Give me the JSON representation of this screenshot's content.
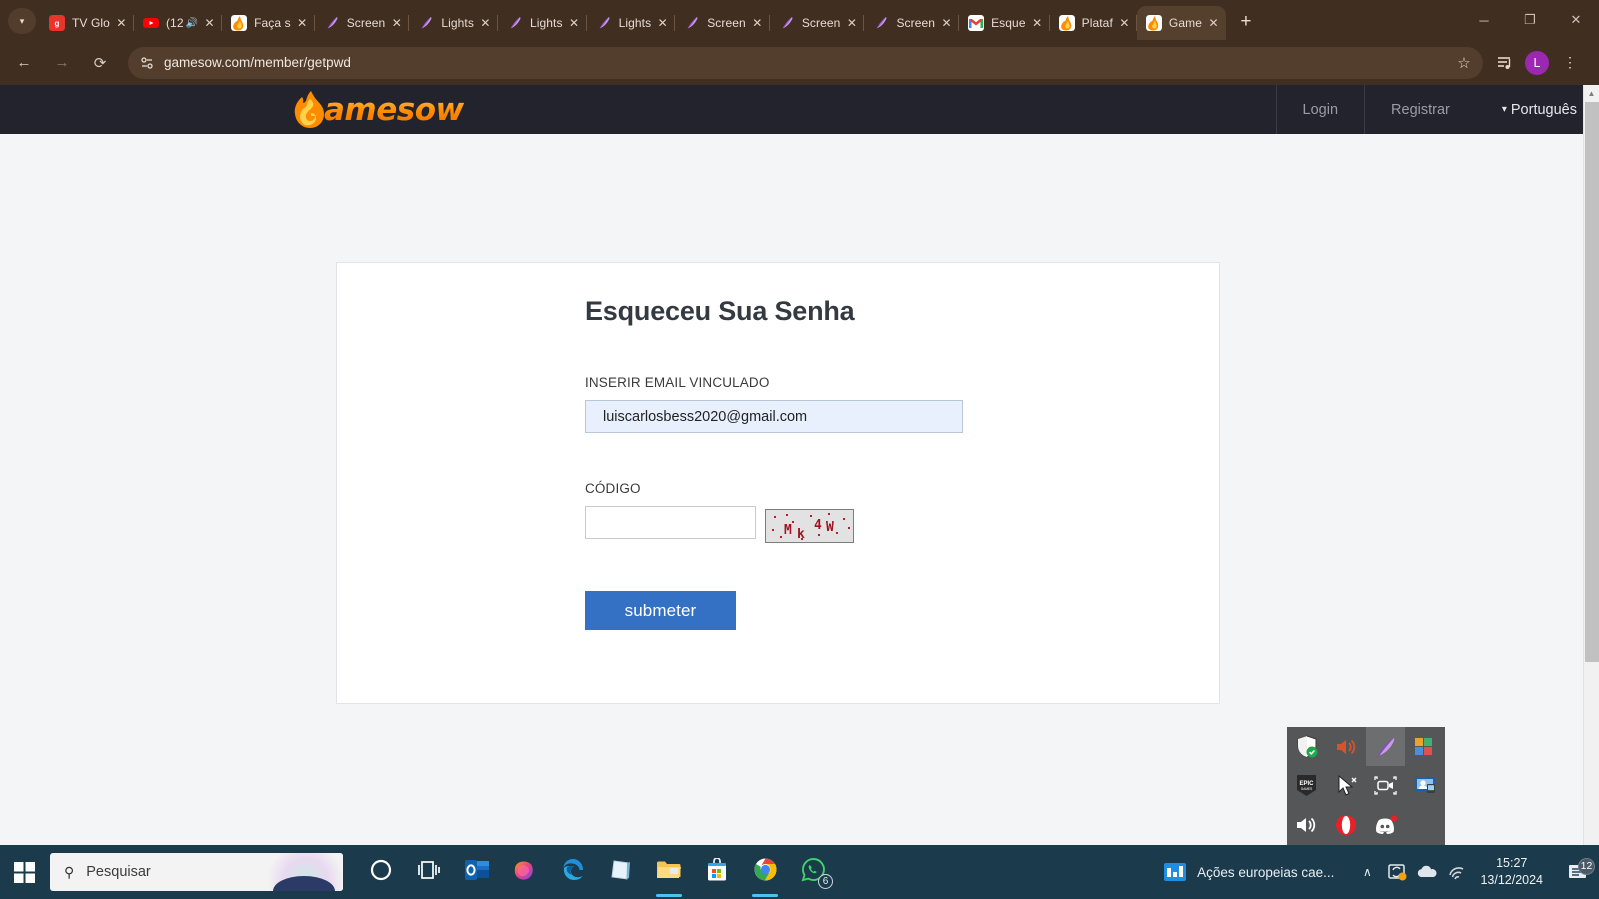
{
  "browser": {
    "tabs": [
      {
        "title": "TV Glo",
        "icon": "globoplay-icon",
        "color": "#e8342a",
        "glyph": "g",
        "audio": false,
        "active": false
      },
      {
        "title": "(12",
        "icon": "youtube-icon",
        "color": "#ff0000",
        "glyph": "▶",
        "audio": true,
        "active": false
      },
      {
        "title": "Faça s",
        "icon": "gamesow-icon",
        "color": "#f5a623",
        "glyph": "G",
        "audio": false,
        "active": false
      },
      {
        "title": "Screen",
        "icon": "lightshot-icon",
        "color": "transparent",
        "glyph": "✒",
        "audio": false,
        "active": false
      },
      {
        "title": "Lights",
        "icon": "lightshot-icon",
        "color": "transparent",
        "glyph": "✒",
        "audio": false,
        "active": false
      },
      {
        "title": "Lights",
        "icon": "lightshot-icon",
        "color": "transparent",
        "glyph": "✒",
        "audio": false,
        "active": false
      },
      {
        "title": "Lights",
        "icon": "lightshot-icon",
        "color": "transparent",
        "glyph": "✒",
        "audio": false,
        "active": false
      },
      {
        "title": "Screen",
        "icon": "lightshot-icon",
        "color": "transparent",
        "glyph": "✒",
        "audio": false,
        "active": false
      },
      {
        "title": "Screen",
        "icon": "lightshot-icon",
        "color": "transparent",
        "glyph": "✒",
        "audio": false,
        "active": false
      },
      {
        "title": "Screen",
        "icon": "lightshot-icon",
        "color": "transparent",
        "glyph": "✒",
        "audio": false,
        "active": false
      },
      {
        "title": "Esque",
        "icon": "gmail-icon",
        "color": "#ffffff",
        "glyph": "M",
        "audio": false,
        "active": false
      },
      {
        "title": "Plataf",
        "icon": "gamesow-icon",
        "color": "#f5a623",
        "glyph": "G",
        "audio": false,
        "active": false
      },
      {
        "title": "Game",
        "icon": "gamesow-icon",
        "color": "#f5a623",
        "glyph": "G",
        "audio": false,
        "active": true
      }
    ],
    "newtab_label": "+",
    "window_controls": {
      "minimize": "─",
      "maximize": "❐",
      "close": "✕"
    },
    "nav": {
      "back": "←",
      "forward": "→",
      "reload": "⟳"
    },
    "url": "gamesow.com/member/getpwd",
    "bookmark_icon": "☆",
    "reading_list_icon": "☰",
    "profile_initial": "L",
    "menu_icon": "⋮"
  },
  "site": {
    "logo_text": "amesow",
    "nav": [
      {
        "label": "Login"
      },
      {
        "label": "Registrar"
      }
    ],
    "language": {
      "caret": "▾",
      "label": "Português"
    }
  },
  "form": {
    "title": "Esqueceu Sua Senha",
    "email_label": "INSERIR EMAIL VINCULADO",
    "email_value": "luiscarlosbess2020@gmail.com",
    "email_placeholder": "",
    "code_label": "CÓDIGO",
    "code_value": "",
    "code_placeholder": "",
    "captcha_text": "Mk4W",
    "captcha_chars": [
      "M",
      "k",
      "4",
      "W"
    ],
    "submit_label": "submeter"
  },
  "tray_flyout": {
    "icons": [
      {
        "name": "security-shield-icon",
        "glyph": "Ὦ",
        "selected": false
      },
      {
        "name": "volume-mute-icon",
        "glyph": "🔊",
        "selected": false
      },
      {
        "name": "lightshot-feather-icon",
        "glyph": "✒",
        "selected": true
      },
      {
        "name": "nvidia-colors-icon",
        "glyph": "▣",
        "selected": false
      },
      {
        "name": "epic-games-icon",
        "glyph": "E",
        "selected": false
      },
      {
        "name": "cursor-arrow-icon",
        "glyph": "➤",
        "selected": false
      },
      {
        "name": "screen-record-icon",
        "glyph": "□",
        "selected": false
      },
      {
        "name": "remote-desktop-icon",
        "glyph": "■",
        "selected": false
      },
      {
        "name": "volume-icon",
        "glyph": "🔊",
        "selected": false
      },
      {
        "name": "opera-icon",
        "glyph": "O",
        "selected": false
      },
      {
        "name": "discord-icon",
        "glyph": "●",
        "selected": false
      }
    ]
  },
  "taskbar": {
    "start_label": "",
    "search_placeholder": "Pesquisar",
    "apps": [
      {
        "name": "copilot-circle-icon",
        "running": false
      },
      {
        "name": "task-view-icon",
        "running": false
      },
      {
        "name": "outlook-icon",
        "running": false
      },
      {
        "name": "copilot-icon",
        "running": false
      },
      {
        "name": "edge-icon",
        "running": false
      },
      {
        "name": "onenote-icon",
        "running": false
      },
      {
        "name": "file-explorer-icon",
        "running": true
      },
      {
        "name": "microsoft-store-icon",
        "running": false
      },
      {
        "name": "chrome-icon",
        "running": true
      },
      {
        "name": "whatsapp-icon",
        "running": false,
        "badge": "6"
      }
    ],
    "news_headline": "Ações europeias cae...",
    "tray_chevron": "∧",
    "time": "15:27",
    "date": "13/12/2024",
    "notification_count": "12"
  }
}
